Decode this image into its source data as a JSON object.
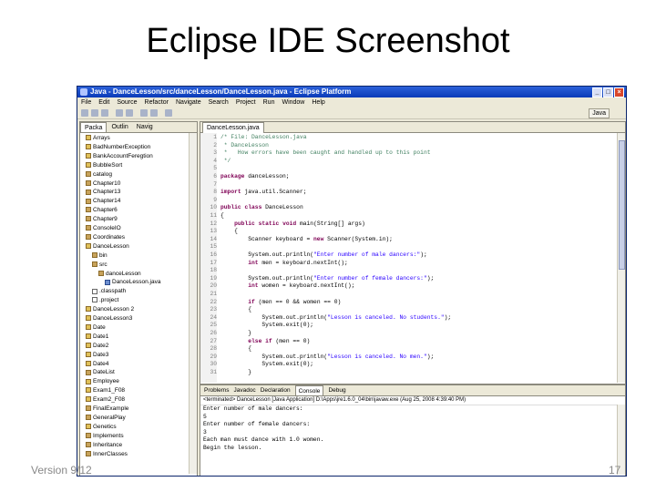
{
  "slide": {
    "title": "Eclipse IDE Screenshot",
    "footer_left": "Version 9/12",
    "page_number": "17"
  },
  "window": {
    "title": "Java - DanceLesson/src/danceLesson/DanceLesson.java - Eclipse Platform",
    "menu": [
      "File",
      "Edit",
      "Source",
      "Refactor",
      "Navigate",
      "Search",
      "Project",
      "Run",
      "Window",
      "Help"
    ],
    "perspective": "Java"
  },
  "package_explorer": {
    "tabs": [
      "Packa",
      "Outlin",
      "Navig"
    ],
    "items": [
      {
        "label": "Arrays",
        "depth": 0,
        "kind": "proj"
      },
      {
        "label": "BadNumberException",
        "depth": 0,
        "kind": "proj"
      },
      {
        "label": "BankAccountFeregtion",
        "depth": 0,
        "kind": "proj"
      },
      {
        "label": "BubbleSort",
        "depth": 0,
        "kind": "proj"
      },
      {
        "label": "catalog",
        "depth": 0,
        "kind": "pkg"
      },
      {
        "label": "Chapter10",
        "depth": 0,
        "kind": "pkg"
      },
      {
        "label": "Chapter13",
        "depth": 0,
        "kind": "pkg"
      },
      {
        "label": "Chapter14",
        "depth": 0,
        "kind": "pkg"
      },
      {
        "label": "Chapter6",
        "depth": 0,
        "kind": "pkg"
      },
      {
        "label": "Chapter9",
        "depth": 0,
        "kind": "pkg"
      },
      {
        "label": "ConsoleIO",
        "depth": 0,
        "kind": "pkg"
      },
      {
        "label": "Coordinates",
        "depth": 0,
        "kind": "pkg"
      },
      {
        "label": "DanceLesson",
        "depth": 0,
        "kind": "proj"
      },
      {
        "label": "bin",
        "depth": 1,
        "kind": "pkg"
      },
      {
        "label": "src",
        "depth": 1,
        "kind": "pkg"
      },
      {
        "label": "danceLesson",
        "depth": 2,
        "kind": "pkg"
      },
      {
        "label": "DanceLesson.java",
        "depth": 3,
        "kind": "java"
      },
      {
        "label": ".classpath",
        "depth": 1,
        "kind": "file"
      },
      {
        "label": ".project",
        "depth": 1,
        "kind": "file"
      },
      {
        "label": "DanceLesson 2",
        "depth": 0,
        "kind": "proj"
      },
      {
        "label": "DanceLesson3",
        "depth": 0,
        "kind": "proj"
      },
      {
        "label": "Date",
        "depth": 0,
        "kind": "proj"
      },
      {
        "label": "Date1",
        "depth": 0,
        "kind": "proj"
      },
      {
        "label": "Date2",
        "depth": 0,
        "kind": "proj"
      },
      {
        "label": "Date3",
        "depth": 0,
        "kind": "proj"
      },
      {
        "label": "Date4",
        "depth": 0,
        "kind": "proj"
      },
      {
        "label": "DateList",
        "depth": 0,
        "kind": "pkg"
      },
      {
        "label": "Employee",
        "depth": 0,
        "kind": "proj"
      },
      {
        "label": "Exam1_F08",
        "depth": 0,
        "kind": "proj"
      },
      {
        "label": "Exam2_F08",
        "depth": 0,
        "kind": "proj"
      },
      {
        "label": "FinalExample",
        "depth": 0,
        "kind": "pkg"
      },
      {
        "label": "GeneralPlay",
        "depth": 0,
        "kind": "pkg"
      },
      {
        "label": "Genetics",
        "depth": 0,
        "kind": "proj"
      },
      {
        "label": "Implements",
        "depth": 0,
        "kind": "pkg"
      },
      {
        "label": "Inheritance",
        "depth": 0,
        "kind": "pkg"
      },
      {
        "label": "InnerClasses",
        "depth": 0,
        "kind": "pkg"
      }
    ]
  },
  "editor": {
    "tab": "DanceLesson.java",
    "lines": [
      {
        "n": "1",
        "text": "/* File: DanceLesson.java"
      },
      {
        "n": "2",
        "text": " * DanceLesson"
      },
      {
        "n": "3",
        "text": " *   How errors have been caught and handled up to this point"
      },
      {
        "n": "4",
        "text": " */"
      },
      {
        "n": "5",
        "text": ""
      },
      {
        "n": "6",
        "text": "package danceLesson;"
      },
      {
        "n": "7",
        "text": ""
      },
      {
        "n": "8",
        "text": "import java.util.Scanner;"
      },
      {
        "n": "9",
        "text": ""
      },
      {
        "n": "10",
        "text": "public class DanceLesson"
      },
      {
        "n": "11",
        "text": "{"
      },
      {
        "n": "12",
        "text": "    public static void main(String[] args)"
      },
      {
        "n": "13",
        "text": "    {"
      },
      {
        "n": "14",
        "text": "        Scanner keyboard = new Scanner(System.in);"
      },
      {
        "n": "15",
        "text": ""
      },
      {
        "n": "16",
        "text": "        System.out.println(\"Enter number of male dancers:\");"
      },
      {
        "n": "17",
        "text": "        int men = keyboard.nextInt();"
      },
      {
        "n": "18",
        "text": ""
      },
      {
        "n": "19",
        "text": "        System.out.println(\"Enter number of female dancers:\");"
      },
      {
        "n": "20",
        "text": "        int women = keyboard.nextInt();"
      },
      {
        "n": "21",
        "text": ""
      },
      {
        "n": "22",
        "text": "        if (men == 0 && women == 0)"
      },
      {
        "n": "23",
        "text": "        {"
      },
      {
        "n": "24",
        "text": "            System.out.println(\"Lesson is canceled. No students.\");"
      },
      {
        "n": "25",
        "text": "            System.exit(0);"
      },
      {
        "n": "26",
        "text": "        }"
      },
      {
        "n": "27",
        "text": "        else if (men == 0)"
      },
      {
        "n": "28",
        "text": "        {"
      },
      {
        "n": "29",
        "text": "            System.out.println(\"Lesson is canceled. No men.\");"
      },
      {
        "n": "30",
        "text": "            System.exit(0);"
      },
      {
        "n": "31",
        "text": "        }"
      }
    ]
  },
  "console": {
    "tabs": [
      "Problems",
      "Javadoc",
      "Declaration",
      "Console",
      "Debug"
    ],
    "active_tab": "Console",
    "status": "<terminated> DanceLesson [Java Application] D:\\Apps\\jre1.6.0_04\\bin\\javaw.exe (Aug 25, 2008 4:39:40 PM)",
    "lines": [
      "Enter number of male dancers:",
      "5",
      "Enter number of female dancers:",
      "3",
      "Each man must dance with 1.0 women.",
      "Begin the lesson."
    ]
  },
  "colors": {
    "titlebar": "#0a3ab8",
    "keyword": "#7f0055",
    "comment": "#3f7f5f",
    "string": "#2a00ff"
  }
}
